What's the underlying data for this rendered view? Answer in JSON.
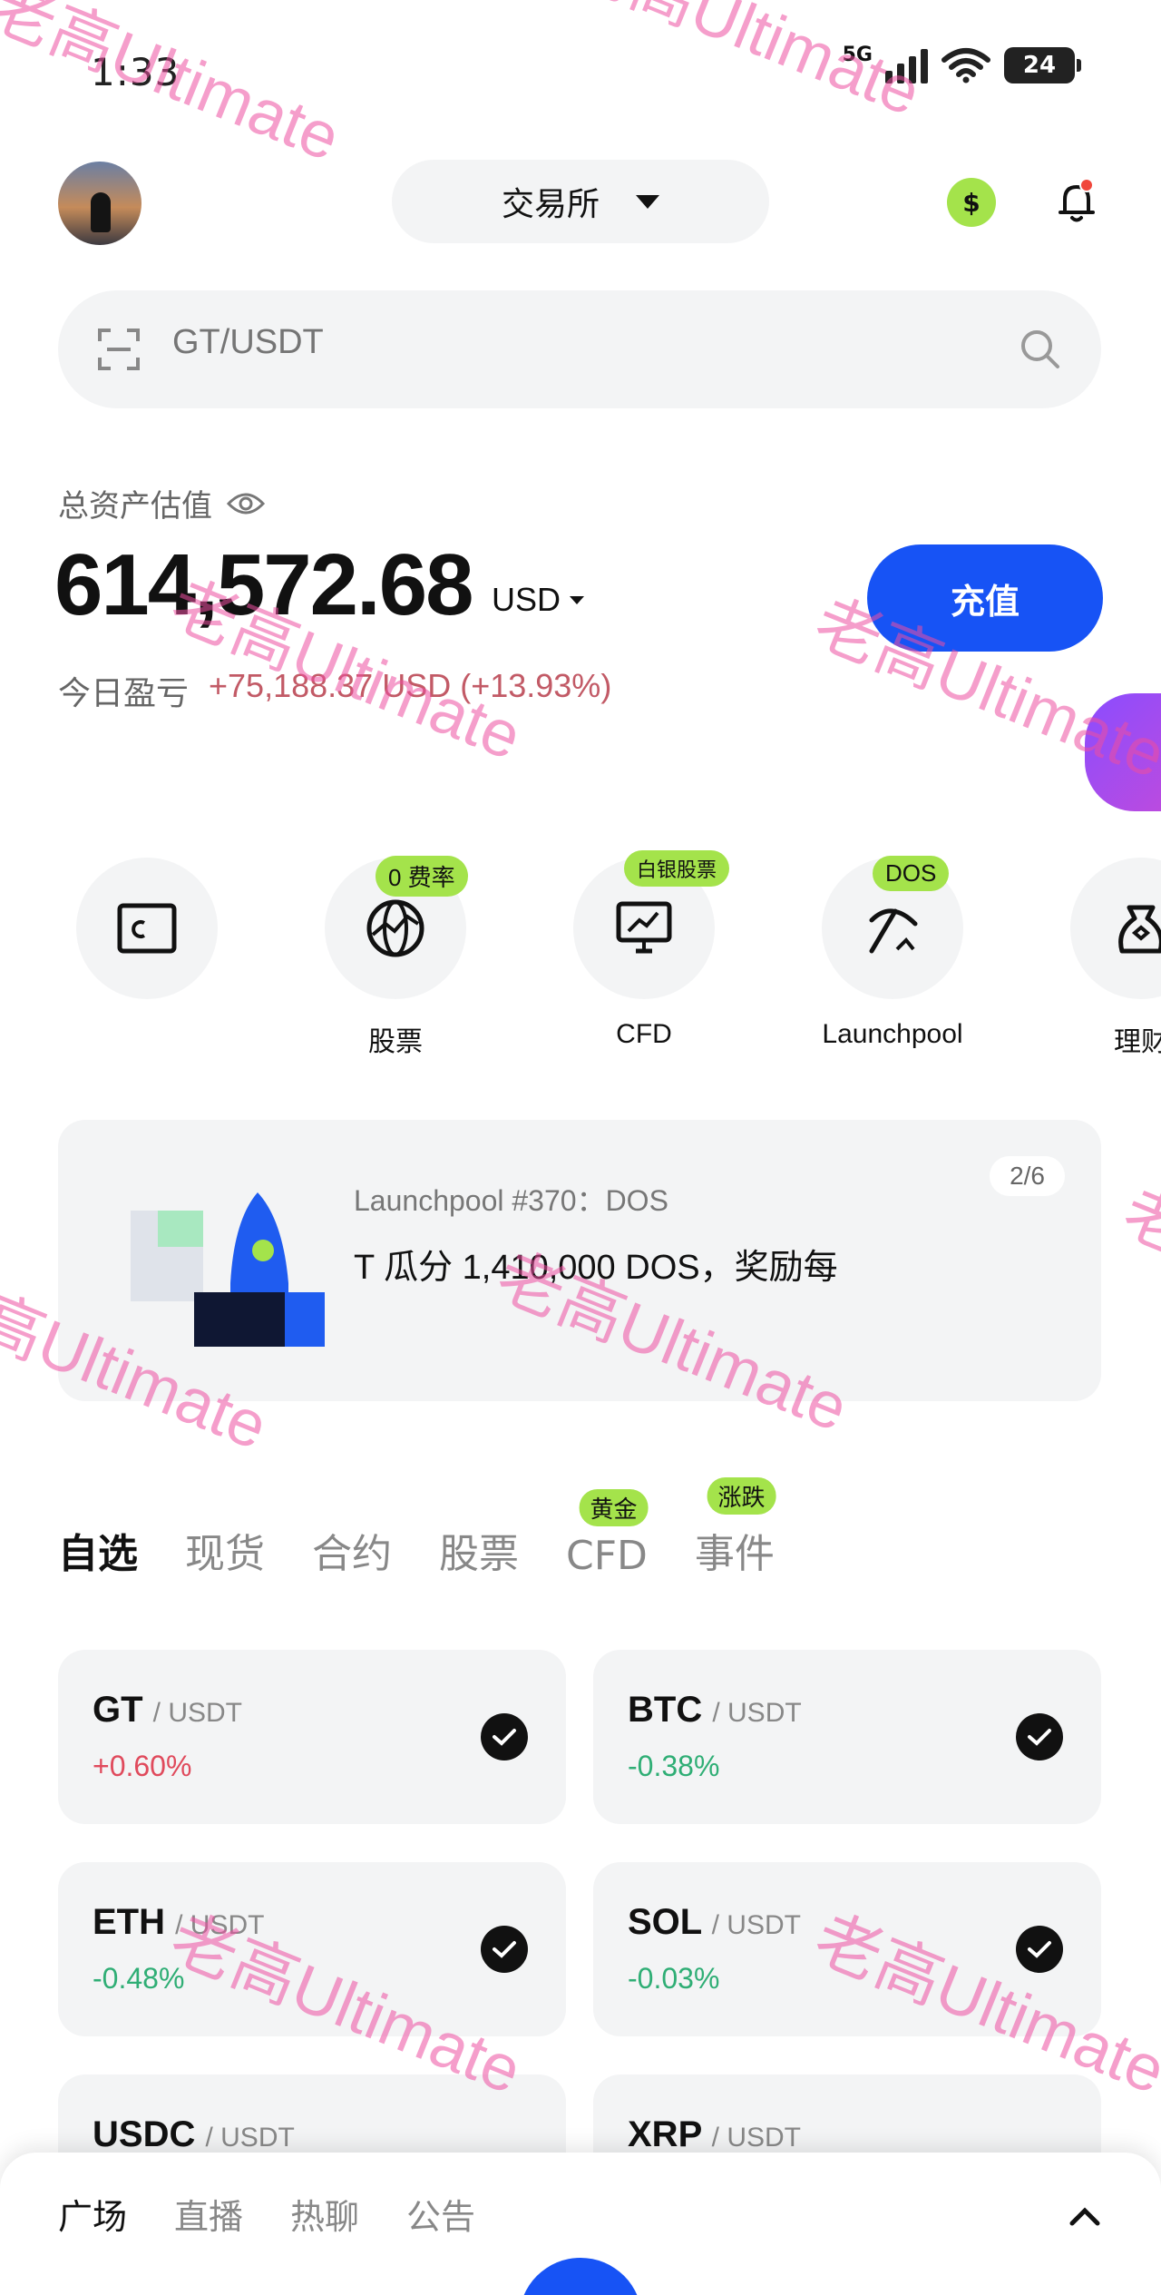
{
  "status_bar": {
    "time": "1:33",
    "network": "5G",
    "battery": "24"
  },
  "header": {
    "exchange_label": "交易所"
  },
  "search": {
    "placeholder": "GT/USDT"
  },
  "balance": {
    "label": "总资产估值",
    "value": "614,572.68",
    "currency": "USD",
    "pnl_label": "今日盈亏",
    "pnl_value": "+75,188.37 USD (+13.93%)",
    "deposit_label": "充值"
  },
  "quick_actions": [
    {
      "label": "",
      "icon": "wallet-icon",
      "badge": ""
    },
    {
      "label": "股票",
      "icon": "globe-icon",
      "badge": "0 费率"
    },
    {
      "label": "CFD",
      "icon": "chart-monitor-icon",
      "badge": "白银股票"
    },
    {
      "label": "Launchpool",
      "icon": "pickaxe-icon",
      "badge": "DOS"
    },
    {
      "label": "理财",
      "icon": "money-bag-icon",
      "badge": ""
    }
  ],
  "banner": {
    "counter": "2/6",
    "title": "Launchpool #370：DOS",
    "description": "T 瓜分 1,410,000 DOS，奖励每"
  },
  "tabs": [
    {
      "label": "自选",
      "badge": ""
    },
    {
      "label": "现货",
      "badge": ""
    },
    {
      "label": "合约",
      "badge": ""
    },
    {
      "label": "股票",
      "badge": ""
    },
    {
      "label": "CFD",
      "badge": "黄金"
    },
    {
      "label": "事件",
      "badge": "涨跌"
    }
  ],
  "watchlist": [
    {
      "symbol": "GT",
      "quote": "/ USDT",
      "change": "+0.60%",
      "direction": "up"
    },
    {
      "symbol": "BTC",
      "quote": "/ USDT",
      "change": "-0.38%",
      "direction": "down"
    },
    {
      "symbol": "ETH",
      "quote": "/ USDT",
      "change": "-0.48%",
      "direction": "down"
    },
    {
      "symbol": "SOL",
      "quote": "/ USDT",
      "change": "-0.03%",
      "direction": "down"
    },
    {
      "symbol": "USDC",
      "quote": "/ USDT",
      "change": "",
      "direction": ""
    },
    {
      "symbol": "XRP",
      "quote": "/ USDT",
      "change": "",
      "direction": ""
    }
  ],
  "bottom_tabs": [
    "广场",
    "直播",
    "热聊",
    "公告"
  ],
  "watermark": "老高Ultimate",
  "colors": {
    "accent": "#1753f5",
    "badge": "#a4e34b",
    "up": "#e04a5c",
    "down": "#2fae75"
  }
}
